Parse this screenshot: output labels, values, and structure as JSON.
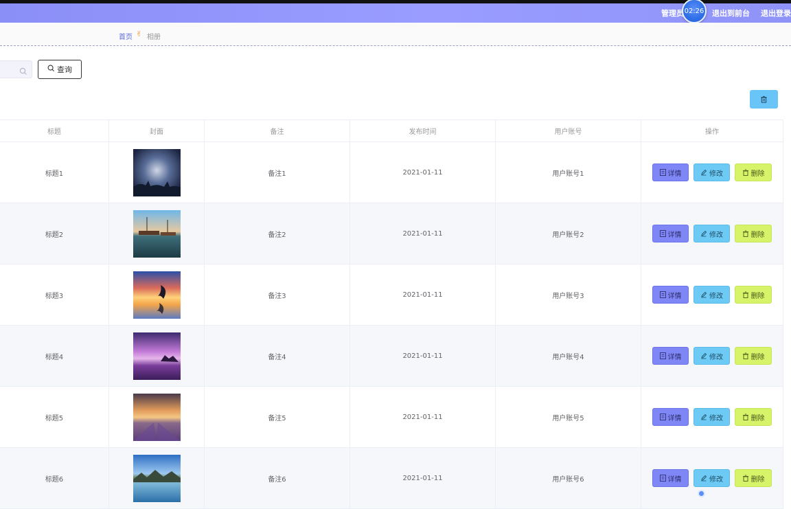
{
  "topbar": {
    "admin_label": "管理员",
    "clock": "02:26",
    "to_front_label": "退出到前台",
    "logout_label": "退出登录"
  },
  "breadcrumb": {
    "home": "首页",
    "current": "相册"
  },
  "search": {
    "value": "",
    "icon": "search-icon",
    "button_label": "查询"
  },
  "table": {
    "headers": [
      "标题",
      "封面",
      "备注",
      "发布时间",
      "用户账号",
      "操作"
    ],
    "buttons": {
      "detail": "详情",
      "edit": "修改",
      "delete": "删除"
    },
    "rows": [
      {
        "title": "标题1",
        "note": "备注1",
        "time": "2021-01-11",
        "account": "用户账号1",
        "cover": "night-silhouette"
      },
      {
        "title": "标题2",
        "note": "备注2",
        "time": "2021-01-11",
        "account": "用户账号2",
        "cover": "harbor-boats"
      },
      {
        "title": "标题3",
        "note": "备注3",
        "time": "2021-01-11",
        "account": "用户账号3",
        "cover": "sunset-dolphin"
      },
      {
        "title": "标题4",
        "note": "备注4",
        "time": "2021-01-11",
        "account": "用户账号4",
        "cover": "purple-sea"
      },
      {
        "title": "标题5",
        "note": "备注5",
        "time": "2021-01-11",
        "account": "用户账号5",
        "cover": "lavender-field"
      },
      {
        "title": "标题6",
        "note": "备注6",
        "time": "2021-01-11",
        "account": "用户账号6",
        "cover": "lake-mountains"
      }
    ]
  },
  "colors": {
    "topbar": "#9a9cff",
    "detail_button": "#7f86f5",
    "edit_button": "#6ccaf5",
    "delete_button": "#d6f36a",
    "batch_delete": "#69c5f7"
  }
}
